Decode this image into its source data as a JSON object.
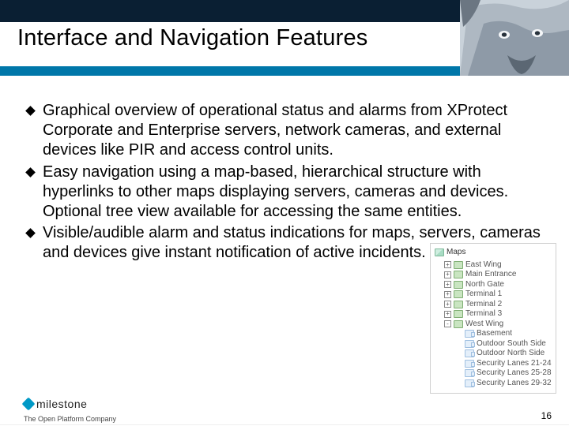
{
  "header": {
    "title": "Interface and Navigation Features"
  },
  "bullets": [
    "Graphical overview of operational status and alarms from XProtect Corporate and Enterprise servers, network cameras, and external devices like PIR and access control units.",
    "Easy navigation using a map-based, hierarchical structure with hyperlinks to other maps displaying servers, cameras and devices. Optional tree view available for accessing the same entities.",
    "Visible/audible alarm and status indications for maps, servers, cameras and devices give instant notification of active incidents."
  ],
  "tree": {
    "title": "Maps",
    "nodes": [
      {
        "label": "East Wing",
        "level": 1,
        "expander": "+",
        "icon": "folder"
      },
      {
        "label": "Main Entrance",
        "level": 1,
        "expander": "+",
        "icon": "folder"
      },
      {
        "label": "North Gate",
        "level": 1,
        "expander": "+",
        "icon": "folder"
      },
      {
        "label": "Terminal 1",
        "level": 1,
        "expander": "+",
        "icon": "folder"
      },
      {
        "label": "Terminal 2",
        "level": 1,
        "expander": "+",
        "icon": "folder"
      },
      {
        "label": "Terminal 3",
        "level": 1,
        "expander": "+",
        "icon": "folder"
      },
      {
        "label": "West Wing",
        "level": 1,
        "expander": "-",
        "icon": "folder"
      },
      {
        "label": "Basement",
        "level": 2,
        "expander": "",
        "icon": "cam"
      },
      {
        "label": "Outdoor South Side",
        "level": 2,
        "expander": "",
        "icon": "cam"
      },
      {
        "label": "Outdoor North Side",
        "level": 2,
        "expander": "",
        "icon": "cam"
      },
      {
        "label": "Security Lanes 21-24",
        "level": 2,
        "expander": "",
        "icon": "cam"
      },
      {
        "label": "Security Lanes 25-28",
        "level": 2,
        "expander": "",
        "icon": "cam"
      },
      {
        "label": "Security Lanes 29-32",
        "level": 2,
        "expander": "",
        "icon": "cam"
      }
    ]
  },
  "footer": {
    "logo_text": "milestone",
    "tagline": "The Open Platform Company",
    "page_number": "16"
  }
}
